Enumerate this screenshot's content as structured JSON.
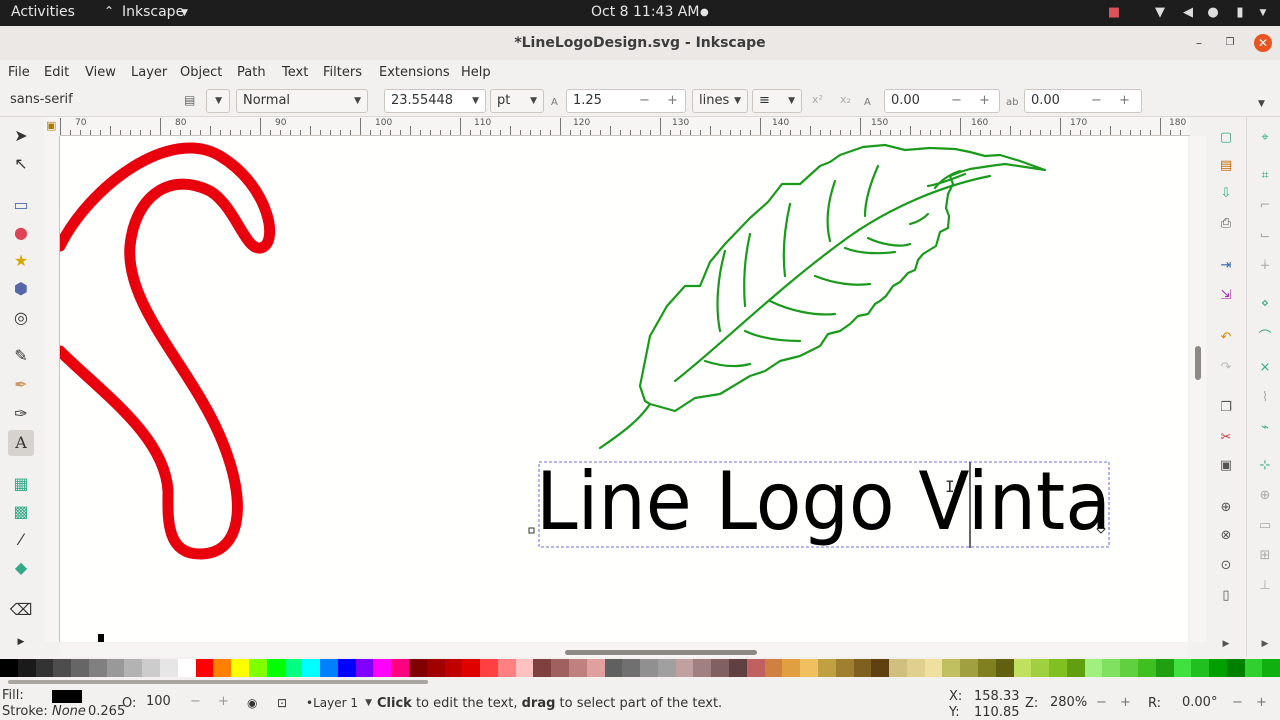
{
  "topbar": {
    "activities": "Activities",
    "app_name": "Inkscape",
    "datetime": "Oct 8  11:43 AM"
  },
  "window": {
    "title": "*LineLogoDesign.svg - Inkscape"
  },
  "menu": [
    "File",
    "Edit",
    "View",
    "Layer",
    "Object",
    "Path",
    "Text",
    "Filters",
    "Extensions",
    "Help"
  ],
  "text_toolbar": {
    "font_family": "sans-serif",
    "font_style": "Normal",
    "font_size": "23.55448",
    "unit": "pt",
    "line_spacing": "1.25",
    "spacing_mode": "lines",
    "letter_spacing": "0.00",
    "word_spacing": "0.00"
  },
  "ruler": {
    "labels": [
      "70",
      "80",
      "90",
      "100",
      "110",
      "120",
      "130",
      "140",
      "150",
      "160",
      "170",
      "180"
    ]
  },
  "canvas": {
    "logo_text": "Line Logo Vinta",
    "leaf_color": "#1a9a1a",
    "curve_color": "#e8000c"
  },
  "status": {
    "fill_label": "Fill:",
    "fill_color": "#000000",
    "stroke_label": "Stroke:",
    "stroke_value": "None",
    "stroke_width": "0.265",
    "opacity_label": "O:",
    "opacity": "100",
    "layer": "•Layer 1",
    "hint_click": "Click",
    "hint_mid": " to edit the text, ",
    "hint_drag": "drag",
    "hint_end": " to select part of the text.",
    "x_label": "X:",
    "x_value": "158.33",
    "y_label": "Y:",
    "y_value": "110.85",
    "zoom_label": "Z:",
    "zoom": "280%",
    "rotation_label": "R:",
    "rotation": "0.00°"
  },
  "palette": [
    "#000000",
    "#1a1a1a",
    "#333333",
    "#4d4d4d",
    "#666666",
    "#808080",
    "#999999",
    "#b3b3b3",
    "#cccccc",
    "#e6e6e6",
    "#ffffff",
    "#ff0000",
    "#ff8000",
    "#ffff00",
    "#80ff00",
    "#00ff00",
    "#00ff80",
    "#00ffff",
    "#0080ff",
    "#0000ff",
    "#8000ff",
    "#ff00ff",
    "#ff0080",
    "#800000",
    "#a00000",
    "#c00000",
    "#e00000",
    "#ff4040",
    "#ff8080",
    "#ffc0c0",
    "#804040",
    "#a06060",
    "#c08080",
    "#e0a0a0",
    "#606060",
    "#707070",
    "#909090",
    "#a0a0a0",
    "#c0a0a0",
    "#a08080",
    "#806060",
    "#604040",
    "#c06060",
    "#d08040",
    "#e0a040",
    "#f0c060",
    "#c0a040",
    "#a08030",
    "#806020",
    "#604010",
    "#d0c080",
    "#e0d090",
    "#f0e0a0",
    "#c0c060",
    "#a0a040",
    "#808020",
    "#606010",
    "#c0e060",
    "#a0d040",
    "#80c020",
    "#60a010",
    "#a0f080",
    "#80e060",
    "#60d040",
    "#40c020",
    "#20a010",
    "#40e040",
    "#20c020",
    "#00a000",
    "#008000",
    "#30d030",
    "#10b010"
  ]
}
